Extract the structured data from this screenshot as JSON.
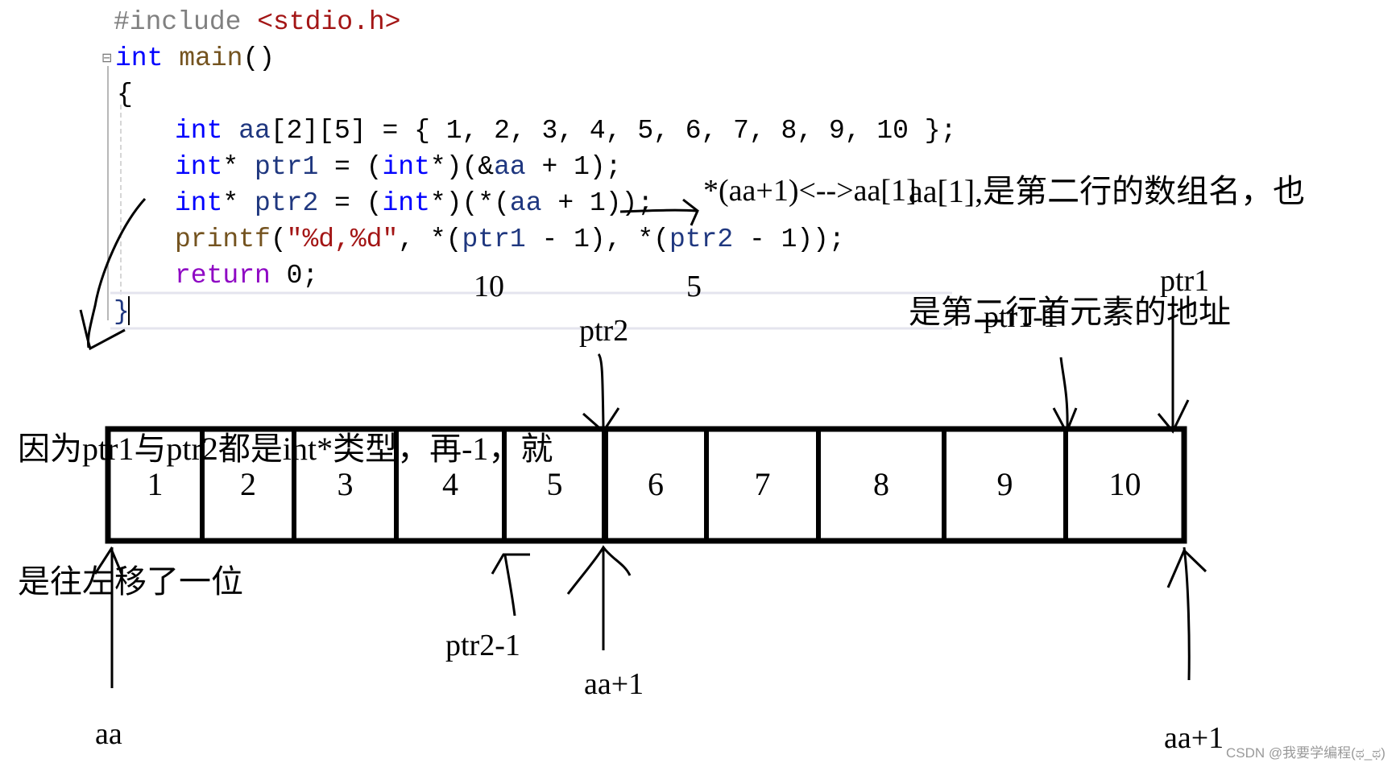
{
  "code": {
    "include": {
      "directive": "#include",
      "header": "<stdio.h>"
    },
    "main_sig": {
      "type": "int",
      "name": "main",
      "parens": "()"
    },
    "open_brace": "{",
    "line_array": {
      "type": "int",
      "name": "aa",
      "dims": "[2][5]",
      "rest": " = { 1, 2, 3, 4, 5, 6, 7, 8, 9, 10 };"
    },
    "line_ptr1": {
      "type": "int",
      "star": "* ",
      "name": "ptr1",
      "eq": " = (",
      "cast_type": "int",
      "cast_rest": "*)(&",
      "operand": "aa",
      "tail": " + 1);"
    },
    "line_ptr2": {
      "type": "int",
      "star": "* ",
      "name": "ptr2",
      "eq": " = (",
      "cast_type": "int",
      "cast_rest": "*)(*(",
      "operand": "aa",
      "tail": " + 1));"
    },
    "line_printf": {
      "fn": "printf",
      "open": "(",
      "fmt": "\"%d,%d\"",
      "mid1": ", *(",
      "p1": "ptr1",
      "mid2": " - 1), *(",
      "p2": "ptr2",
      "tail": " - 1));"
    },
    "line_return": {
      "kw": "return",
      "tail": " 0;"
    },
    "close_brace": "}",
    "collapse_icon": "⊟"
  },
  "annotations": {
    "output_values": [
      "10",
      "5"
    ],
    "equivalence": "*(aa+1)<-->aa[1]",
    "note_row": [
      "aa[1],是第二行的数组名，也",
      "是第二行首元素的地址"
    ],
    "note_shift": [
      "因为ptr1与ptr2都是int*类型，再-1，就",
      "是往左移了一位"
    ]
  },
  "array": {
    "cells": [
      "1",
      "2",
      "3",
      "4",
      "5",
      "6",
      "7",
      "8",
      "9",
      "10"
    ]
  },
  "pointer_labels": {
    "ptr2": "ptr2",
    "ptr1_minus_1": "ptr1-1",
    "ptr1": "ptr1",
    "aa": "aa",
    "ptr2_minus_1": "ptr2-1",
    "aa_plus_1_mid": "aa+1",
    "aa_plus_1_end": "aa+1"
  },
  "watermark": "CSDN @我要学编程(ಥ_ಥ)"
}
